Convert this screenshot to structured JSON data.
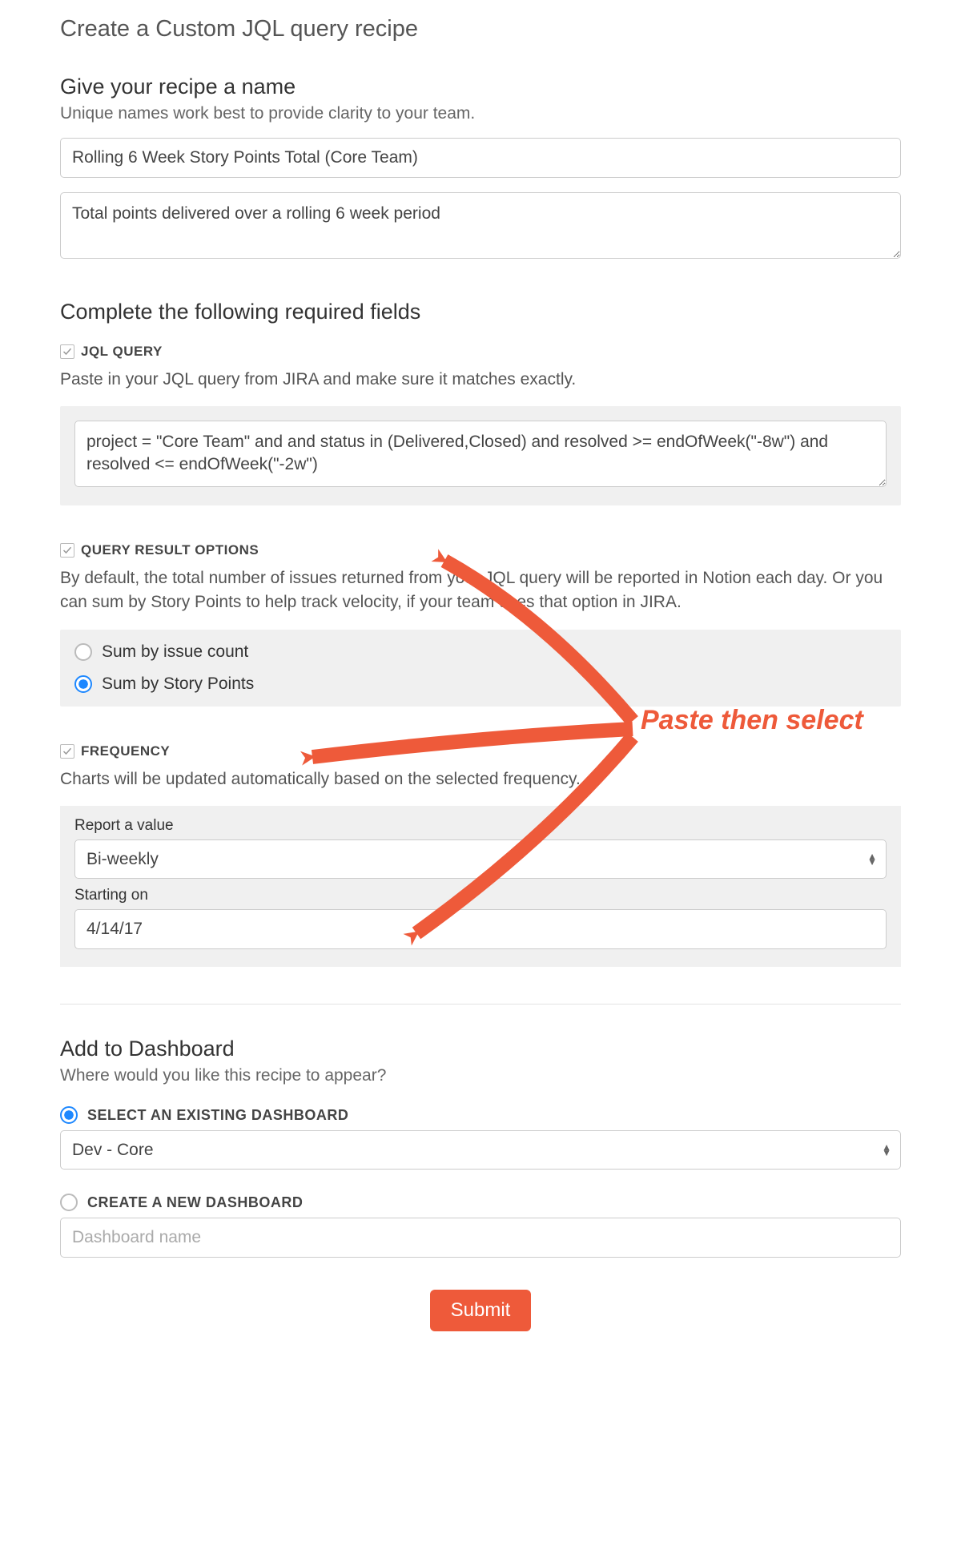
{
  "page": {
    "title": "Create a Custom JQL query recipe"
  },
  "name_section": {
    "heading": "Give your recipe a name",
    "hint": "Unique names work best to provide clarity to your team.",
    "name_value": "Rolling 6 Week Story Points Total (Core Team)",
    "desc_value": "Total points delivered over a rolling 6 week period"
  },
  "required_section": {
    "heading": "Complete the following required fields"
  },
  "jql": {
    "label": "JQL QUERY",
    "hint": "Paste in your JQL query from JIRA and make sure it matches exactly.",
    "value": "project = \"Core Team\" and and status in (Delivered,Closed) and resolved >= endOfWeek(\"-8w\") and resolved <= endOfWeek(\"-2w\")"
  },
  "result_options": {
    "label": "QUERY RESULT OPTIONS",
    "hint": "By default, the total number of issues returned from your JQL query will be reported in Notion each day. Or you can sum by Story Points to help track velocity, if your team uses that option in JIRA.",
    "option_issue": "Sum by issue count",
    "option_points": "Sum by Story Points",
    "selected": "points"
  },
  "frequency": {
    "label": "FREQUENCY",
    "hint": "Charts will be updated automatically based on the selected frequency.",
    "report_label": "Report a value",
    "report_value": "Bi-weekly",
    "starting_label": "Starting on",
    "starting_value": "4/14/17"
  },
  "dashboard": {
    "heading": "Add to Dashboard",
    "hint": "Where would you like this recipe to appear?",
    "option_existing": "SELECT AN EXISTING DASHBOARD",
    "existing_value": "Dev - Core",
    "option_new": "CREATE A NEW DASHBOARD",
    "new_placeholder": "Dashboard name",
    "selected": "existing"
  },
  "submit": {
    "label": "Submit"
  },
  "annotation": {
    "text": "Paste then select"
  }
}
